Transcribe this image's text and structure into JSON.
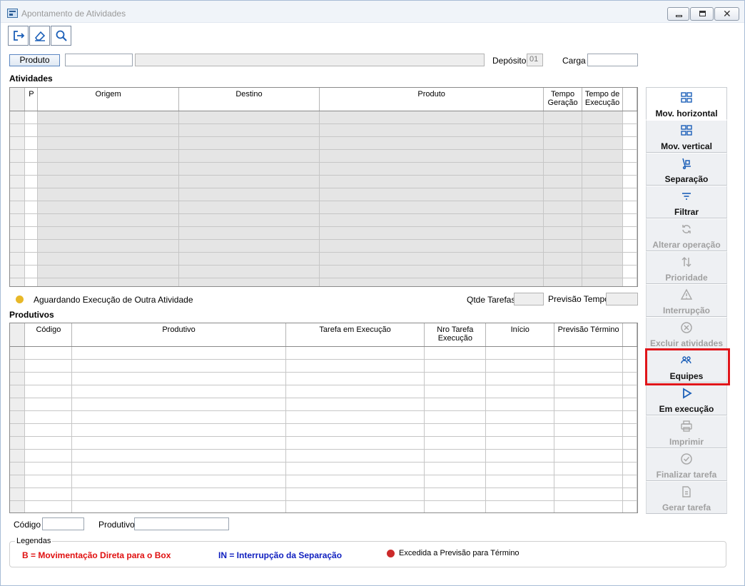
{
  "window": {
    "title": "Apontamento de Atividades"
  },
  "toolbar": {
    "buttons": [
      "exit",
      "eraser",
      "search"
    ]
  },
  "filters": {
    "produto_button": "Produto",
    "produto_code": "",
    "produto_desc": "",
    "deposito_label": "Depósito",
    "deposito_value": "01",
    "carga_label": "Carga",
    "carga_value": ""
  },
  "atividades": {
    "title": "Atividades",
    "columns": [
      "P",
      "Origem",
      "Destino",
      "Produto",
      "Tempo Geração",
      "Tempo de Execução"
    ],
    "row_count": 14
  },
  "status": {
    "aguardando_label": "Aguardando Execução de Outra Atividade",
    "aguardando_color": "#e8b828",
    "qtde_tarefas_label": "Qtde Tarefas",
    "qtde_tarefas_value": "",
    "previsao_tempo_label": "Previsão Tempo",
    "previsao_tempo_value": ""
  },
  "produtivos": {
    "title": "Produtivos",
    "columns": [
      "Código",
      "Produtivo",
      "Tarefa em Execução",
      "Nro Tarefa Execução",
      "Início",
      "Previsão Término"
    ],
    "row_count": 13
  },
  "bottom_filters": {
    "codigo_label": "Código",
    "codigo_value": "",
    "produtivo_label": "Produtivo",
    "produtivo_value": ""
  },
  "side_buttons": [
    {
      "label": "Mov. horizontal",
      "icon": "grid-icon",
      "enabled": true
    },
    {
      "label": "Mov. vertical",
      "icon": "grid-icon",
      "enabled": true
    },
    {
      "label": "Separação",
      "icon": "dolly-icon",
      "enabled": true
    },
    {
      "label": "Filtrar",
      "icon": "filter-icon",
      "enabled": true
    },
    {
      "label": "Alterar operação",
      "icon": "refresh-icon",
      "enabled": false
    },
    {
      "label": "Prioridade",
      "icon": "sort-arrows-icon",
      "enabled": false
    },
    {
      "label": "Interrupção",
      "icon": "warning-icon",
      "enabled": false
    },
    {
      "label": "Excluir atividades",
      "icon": "cancel-circle-icon",
      "enabled": false
    },
    {
      "label": "Equipes",
      "icon": "team-icon",
      "enabled": true
    },
    {
      "label": "Em execução",
      "icon": "play-icon",
      "enabled": true
    },
    {
      "label": "Imprimir",
      "icon": "printer-icon",
      "enabled": false
    },
    {
      "label": "Finalizar tarefa",
      "icon": "check-circle-icon",
      "enabled": false
    },
    {
      "label": "Gerar tarefa",
      "icon": "document-icon",
      "enabled": false
    }
  ],
  "legend": {
    "caption": "Legendas",
    "items": [
      {
        "text": "B = Movimentação Direta para o Box",
        "color": "#e01010"
      },
      {
        "text": "IN = Interrupção da Separação",
        "color": "#1020c0"
      },
      {
        "text": "Excedida a Previsão para Término",
        "color": "#cc2a2a"
      }
    ]
  },
  "colors": {
    "accent": "#1b5fb8",
    "highlight": "#e0151a",
    "grid_shade": "#e5e5e5"
  }
}
